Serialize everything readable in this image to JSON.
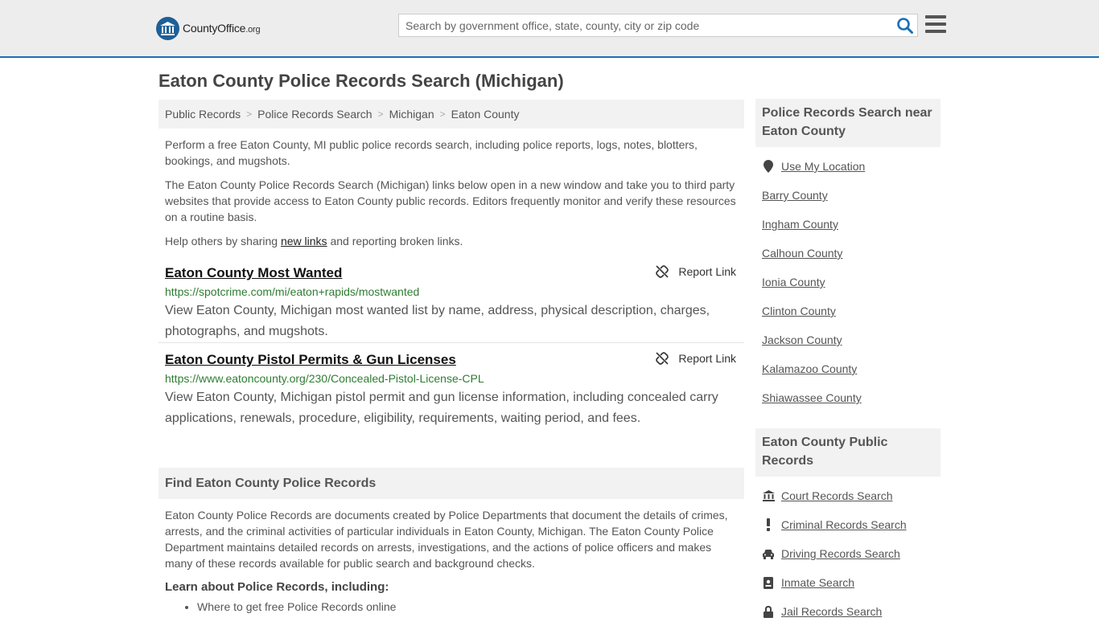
{
  "header": {
    "logo_main": "CountyOffice",
    "logo_org": ".org",
    "search_placeholder": "Search by government office, state, county, city or zip code"
  },
  "page_title": "Eaton County Police Records Search (Michigan)",
  "breadcrumb": [
    "Public Records",
    "Police Records Search",
    "Michigan",
    "Eaton County"
  ],
  "intro": {
    "p1": "Perform a free Eaton County, MI public police records search, including police reports, logs, notes, blotters, bookings, and mugshots.",
    "p2": "The Eaton County Police Records Search (Michigan) links below open in a new window and take you to third party websites that provide access to Eaton County public records. Editors frequently monitor and verify these resources on a routine basis.",
    "p3_before": "Help others by sharing ",
    "p3_link": "new links",
    "p3_after": " and reporting broken links."
  },
  "results": [
    {
      "title": "Eaton County Most Wanted",
      "url": "https://spotcrime.com/mi/eaton+rapids/mostwanted",
      "description": "View Eaton County, Michigan most wanted list by name, address, physical description, charges, photographs, and mugshots.",
      "report_label": "Report Link"
    },
    {
      "title": "Eaton County Pistol Permits & Gun Licenses",
      "url": "https://www.eatoncounty.org/230/Concealed-Pistol-License-CPL",
      "description": "View Eaton County, Michigan pistol permit and gun license information, including concealed carry applications, renewals, procedure, eligibility, requirements, waiting period, and fees.",
      "report_label": "Report Link"
    }
  ],
  "find_section": {
    "heading": "Find Eaton County Police Records",
    "paragraph": "Eaton County Police Records are documents created by Police Departments that document the details of crimes, arrests, and the criminal activities of particular individuals in Eaton County, Michigan. The Eaton County Police Department maintains detailed records on arrests, investigations, and the actions of police officers and makes many of these records available for public search and background checks.",
    "learn_heading": "Learn about Police Records, including:",
    "learn_items": [
      "Where to get free Police Records online"
    ]
  },
  "sidebar_nearby": {
    "heading": "Police Records Search near Eaton County",
    "use_location": "Use My Location",
    "items": [
      "Barry County",
      "Ingham County",
      "Calhoun County",
      "Ionia County",
      "Clinton County",
      "Jackson County",
      "Kalamazoo County",
      "Shiawassee County"
    ]
  },
  "sidebar_public": {
    "heading": "Eaton County Public Records",
    "items": [
      {
        "label": "Court Records Search",
        "icon": "courthouse-icon"
      },
      {
        "label": "Criminal Records Search",
        "icon": "exclamation-icon"
      },
      {
        "label": "Driving Records Search",
        "icon": "car-icon"
      },
      {
        "label": "Inmate Search",
        "icon": "id-badge-icon"
      },
      {
        "label": "Jail Records Search",
        "icon": "lock-icon"
      }
    ]
  },
  "colors": {
    "accent_blue": "#1a6fb5",
    "url_green": "#2e7d32",
    "panel_gray": "#f2f2f2"
  }
}
